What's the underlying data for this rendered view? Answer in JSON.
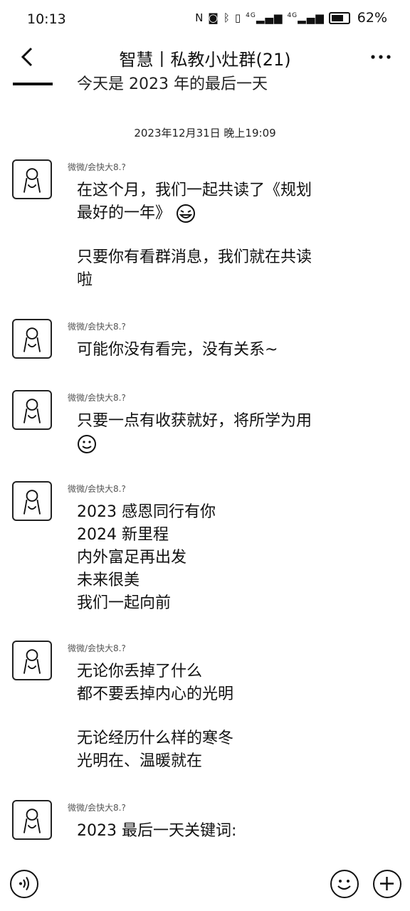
{
  "status_bar": {
    "time": "10:13",
    "icons": [
      "nfc-icon",
      "silent-icon",
      "bluetooth-icon",
      "vibrate-icon",
      "signal-4g-icon",
      "signal-4g-icon"
    ],
    "net_label_1": "4G",
    "net_label_2": "4G",
    "battery": "62%"
  },
  "header": {
    "title": "智慧丨私教小灶群(21)"
  },
  "partial_message": "今天是 2023 年的最后一天",
  "timestamp": "2023年12月31日 晚上19:09",
  "messages": [
    {
      "sender": "微微/会快大8.?",
      "lines_a": [
        "在这个月，我们一起共读了《规划",
        "最好的一年》"
      ],
      "lines_b": [
        "只要你有看群消息，我们就在共读",
        "啦"
      ]
    },
    {
      "sender": "微微/会快大8.?",
      "lines_a": [
        "可能你没有看完，没有关系~"
      ]
    },
    {
      "sender": "微微/会快大8.?",
      "lines_a": [
        "只要一点有收获就好，将所学为用"
      ]
    },
    {
      "sender": "微微/会快大8.?",
      "lines_a": [
        "2023 感恩同行有你",
        "2024 新里程",
        "内外富足再出发",
        "未来很美",
        "我们一起向前"
      ]
    },
    {
      "sender": "微微/会快大8.?",
      "lines_a": [
        "无论你丢掉了什么",
        "都不要丢掉内心的光明"
      ],
      "lines_b": [
        "无论经历什么样的寒冬",
        "光明在、温暖就在"
      ]
    },
    {
      "sender": "微微/会快大8.?",
      "lines_a": [
        "2023 最后一天关键词:"
      ]
    }
  ],
  "input_bar": {
    "icons": [
      "voice-icon",
      "emoji-icon",
      "plus-icon"
    ]
  }
}
